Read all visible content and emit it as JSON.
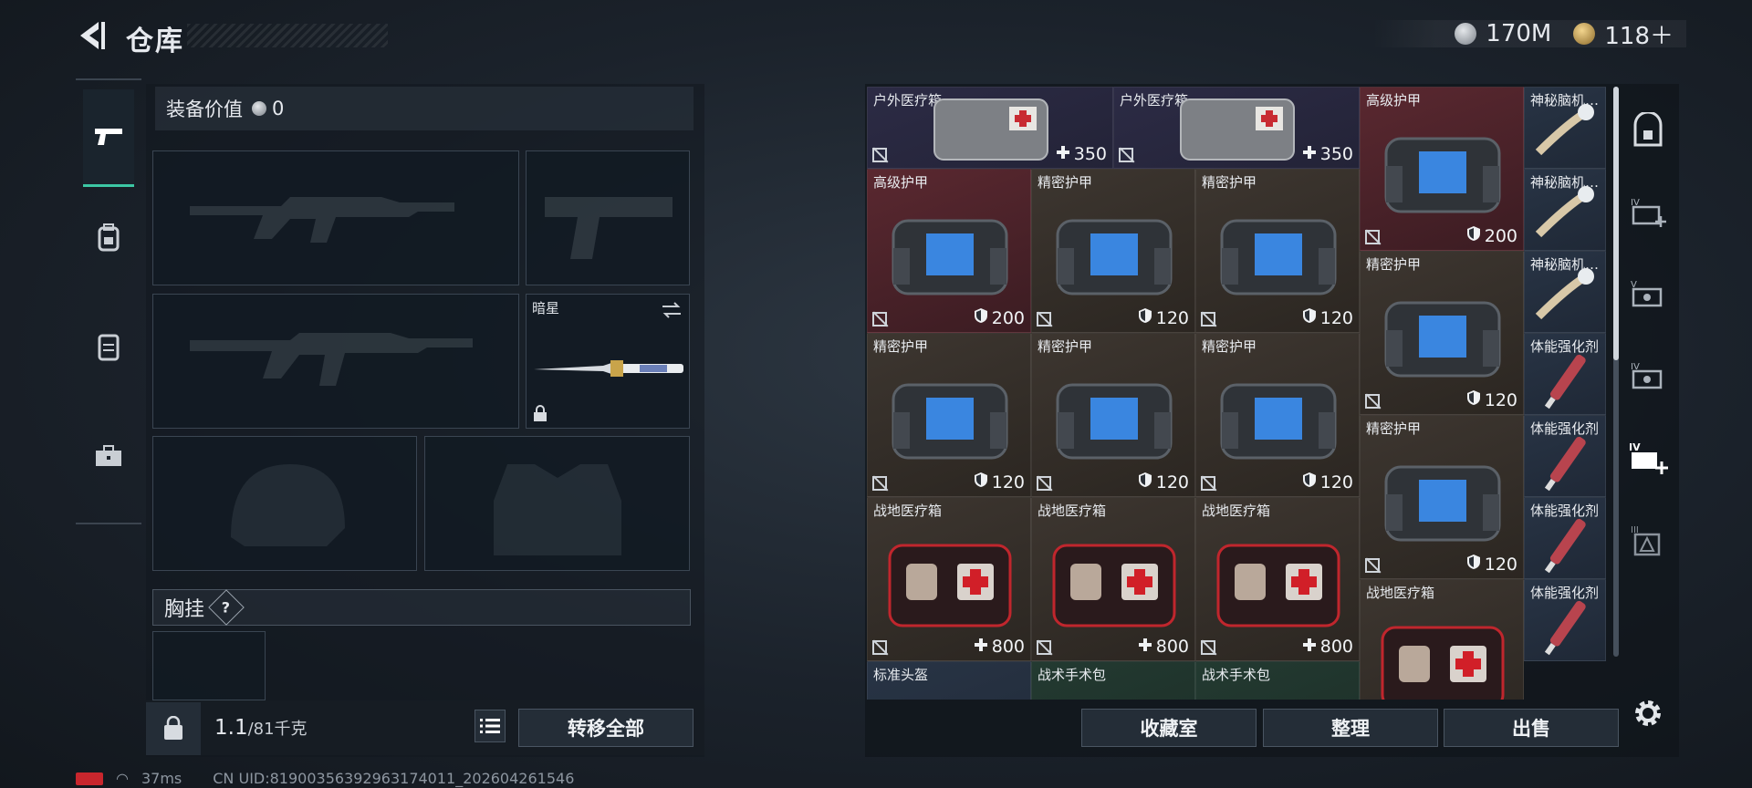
{
  "header": {
    "title": "仓库",
    "currency": [
      {
        "icon": "silver-coin-icon",
        "value": "170M"
      },
      {
        "icon": "gold-coin-icon",
        "value": "118＋"
      }
    ]
  },
  "left_rail": [
    "pistol-icon",
    "backpack-icon",
    "vest-icon",
    "toolbox-icon"
  ],
  "loadout": {
    "value_label": "装备价值",
    "value_amount": "0",
    "melee_name": "暗星",
    "chest_label": "胸挂",
    "chest_help": "?",
    "weight_value": "1.1",
    "weight_max": "/81千克",
    "transfer_all": "转移全部"
  },
  "storage": {
    "cells": [
      {
        "name": "户外医疗箱",
        "value": "350",
        "vt": "heal",
        "color": "purple",
        "item": "medkit-bag"
      },
      {
        "name": "户外医疗箱",
        "value": "350",
        "vt": "heal",
        "color": "purple",
        "item": "medkit-bag"
      },
      {
        "name": "高级护甲",
        "value": "200",
        "vt": "armor",
        "color": "red",
        "item": "armor"
      },
      {
        "name": "神秘脑机…",
        "value": "",
        "vt": "",
        "color": "blue",
        "item": "device"
      },
      {
        "name": "高级护甲",
        "value": "200",
        "vt": "armor",
        "color": "red",
        "item": "armor"
      },
      {
        "name": "精密护甲",
        "value": "120",
        "vt": "armor",
        "color": "brown",
        "item": "armor"
      },
      {
        "name": "精密护甲",
        "value": "120",
        "vt": "armor",
        "color": "brown",
        "item": "armor"
      },
      {
        "name": "神秘脑机…",
        "value": "",
        "vt": "",
        "color": "blue",
        "item": "device"
      },
      {
        "name": "精密护甲",
        "value": "120",
        "vt": "armor",
        "color": "brown",
        "item": "armor"
      },
      {
        "name": "神秘脑机…",
        "value": "",
        "vt": "",
        "color": "blue",
        "item": "device"
      },
      {
        "name": "精密护甲",
        "value": "120",
        "vt": "armor",
        "color": "brown",
        "item": "armor"
      },
      {
        "name": "精密护甲",
        "value": "120",
        "vt": "armor",
        "color": "brown",
        "item": "armor"
      },
      {
        "name": "精密护甲",
        "value": "120",
        "vt": "armor",
        "color": "brown",
        "item": "armor"
      },
      {
        "name": "体能强化剂",
        "value": "",
        "vt": "",
        "color": "blue",
        "item": "syringe"
      },
      {
        "name": "精密护甲",
        "value": "120",
        "vt": "armor",
        "color": "brown",
        "item": "armor"
      },
      {
        "name": "体能强化剂",
        "value": "",
        "vt": "",
        "color": "blue",
        "item": "syringe"
      },
      {
        "name": "战地医疗箱",
        "value": "800",
        "vt": "heal",
        "color": "brown",
        "item": "firstaid"
      },
      {
        "name": "战地医疗箱",
        "value": "800",
        "vt": "heal",
        "color": "brown",
        "item": "firstaid"
      },
      {
        "name": "战地医疗箱",
        "value": "800",
        "vt": "heal",
        "color": "brown",
        "item": "firstaid"
      },
      {
        "name": "体能强化剂",
        "value": "",
        "vt": "",
        "color": "blue",
        "item": "syringe"
      },
      {
        "name": "战地医疗箱",
        "value": "",
        "vt": "",
        "color": "brown",
        "item": "firstaid"
      },
      {
        "name": "标准头盔",
        "value": "",
        "vt": "",
        "color": "blue",
        "item": "helmet"
      },
      {
        "name": "战术手术包",
        "value": "",
        "vt": "",
        "color": "green",
        "item": "surgkit"
      },
      {
        "name": "战术手术包",
        "value": "",
        "vt": "",
        "color": "green",
        "item": "surgkit"
      },
      {
        "name": "体能强化剂",
        "value": "",
        "vt": "",
        "color": "blue",
        "item": "syringe"
      }
    ],
    "buttons": {
      "collection": "收藏室",
      "organize": "整理",
      "sell": "出售"
    }
  },
  "right_rail": [
    "safe-icon",
    "medic-iv-icon",
    "box-v-icon",
    "box-iv-icon",
    "medic-iv-active-icon",
    "armor-iii-icon"
  ],
  "status": {
    "latency": "37ms",
    "uid": "CN UID:81900356392963174011_202604261546"
  }
}
